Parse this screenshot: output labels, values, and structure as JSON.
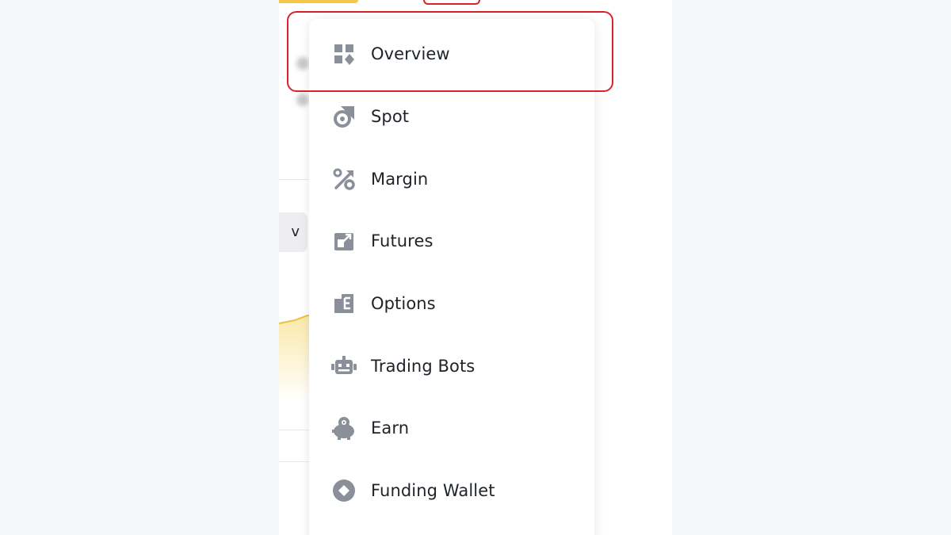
{
  "background_page": {
    "chip_text": "v"
  },
  "menu": {
    "items": [
      {
        "id": "overview",
        "label": "Overview",
        "icon": "grid-icon",
        "highlighted": true
      },
      {
        "id": "spot",
        "label": "Spot",
        "icon": "spot-icon"
      },
      {
        "id": "margin",
        "label": "Margin",
        "icon": "percent-icon"
      },
      {
        "id": "futures",
        "label": "Futures",
        "icon": "futures-icon"
      },
      {
        "id": "options",
        "label": "Options",
        "icon": "options-icon"
      },
      {
        "id": "trading-bots",
        "label": "Trading Bots",
        "icon": "robot-icon"
      },
      {
        "id": "earn",
        "label": "Earn",
        "icon": "piggy-icon"
      },
      {
        "id": "funding-wallet",
        "label": "Funding Wallet",
        "icon": "wallet-icon"
      }
    ]
  },
  "colors": {
    "icon": "#8a8f99",
    "text": "#1e2329",
    "highlight": "#d9232b",
    "accent_yellow": "#f5c84a"
  }
}
